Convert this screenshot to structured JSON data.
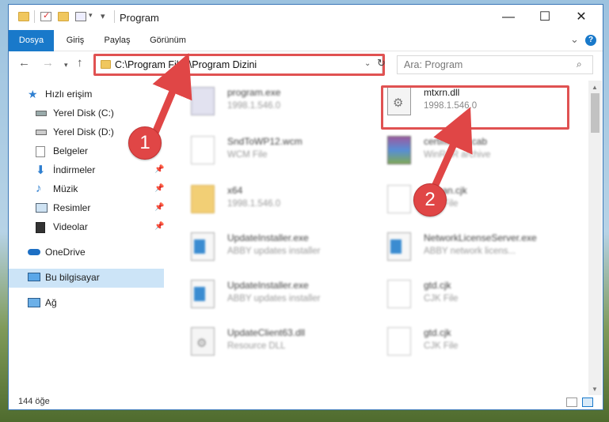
{
  "window": {
    "title": "Program",
    "controls": {
      "minimize": "—",
      "maximize": "☐",
      "close": "✕"
    }
  },
  "ribbon": {
    "tabs": [
      "Dosya",
      "Giriş",
      "Paylaş",
      "Görünüm"
    ],
    "expand_icon": "⌄",
    "help_icon": "?"
  },
  "address": {
    "path": "C:\\Program Files\\Program Dizini",
    "search_placeholder": "Ara: Program"
  },
  "nav_pane": {
    "items": [
      {
        "label": "Hızlı erişim",
        "icon": "star-icon",
        "pinned": false
      },
      {
        "label": "Yerel Disk (C:)",
        "icon": "drive-icon",
        "pinned": false
      },
      {
        "label": "Yerel Disk (D:)",
        "icon": "drive-icon",
        "pinned": false
      },
      {
        "label": "Belgeler",
        "icon": "documents-icon",
        "pinned": false
      },
      {
        "label": "İndirmeler",
        "icon": "download-icon",
        "pinned": true
      },
      {
        "label": "Müzik",
        "icon": "music-icon",
        "pinned": true
      },
      {
        "label": "Resimler",
        "icon": "pictures-icon",
        "pinned": true
      },
      {
        "label": "Videolar",
        "icon": "videos-icon",
        "pinned": true
      },
      {
        "label": "OneDrive",
        "icon": "cloud-icon",
        "pinned": false
      },
      {
        "label": "Bu bilgisayar",
        "icon": "computer-icon",
        "pinned": false,
        "selected": true
      },
      {
        "label": "Ağ",
        "icon": "network-icon",
        "pinned": false
      }
    ]
  },
  "files": [
    {
      "name": "program.exe",
      "sub": "1998.1.546.0",
      "icon": "exe-icon"
    },
    {
      "name": "mtxrn.dll",
      "sub": "1998.1.546.0",
      "icon": "dll-gear-icon"
    },
    {
      "name": "SndToWP12.wcm",
      "sub": "WCM File",
      "icon": "file-icon"
    },
    {
      "name": "certificates.cab",
      "sub": "WinRAR archive",
      "icon": "archive-icon"
    },
    {
      "name": "x64",
      "sub": "1998.1.546.0",
      "icon": "folder-icon"
    },
    {
      "name": "korean.cjk",
      "sub": "CJK File",
      "icon": "file-icon"
    },
    {
      "name": "UpdateInstaller.exe",
      "sub": "ABBY updates installer",
      "icon": "exe-window-icon"
    },
    {
      "name": "NetworkLicenseServer.exe",
      "sub": "ABBY network licens...",
      "icon": "exe-window-icon"
    },
    {
      "name": "UpdateInstaller.exe",
      "sub": "ABBY updates installer",
      "icon": "exe-window-icon"
    },
    {
      "name": "gtd.cjk",
      "sub": "CJK File",
      "icon": "file-icon"
    },
    {
      "name": "UpdateClient63.dll",
      "sub": "Resource DLL",
      "icon": "dll-gear-icon"
    },
    {
      "name": "gtd.cjk",
      "sub": "CJK File",
      "icon": "file-icon"
    }
  ],
  "status": {
    "item_count": "144 öğe"
  },
  "callouts": [
    "1",
    "2"
  ],
  "colors": {
    "accent": "#1979ca",
    "highlight": "#e05252",
    "selected": "#cce4f7"
  }
}
